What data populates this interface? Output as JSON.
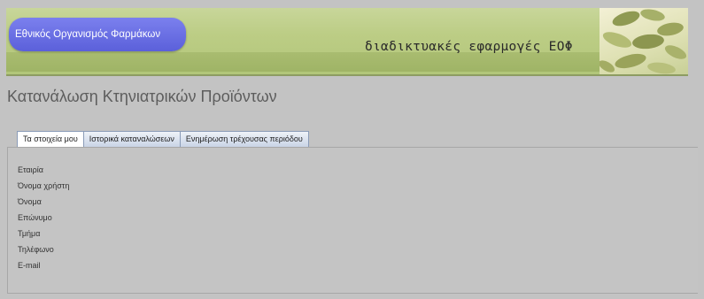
{
  "header": {
    "org_name": "Εθνικός Οργανισμός Φαρμάκων",
    "apps_title": "διαδικτυακές εφαρμογές ΕΟΦ"
  },
  "page": {
    "title": "Κατανάλωση Κτηνιατρικών Προϊόντων"
  },
  "tabs": [
    {
      "label": "Τα στοιχεία μου",
      "active": true
    },
    {
      "label": "Ιστορικά καταναλώσεων",
      "active": false
    },
    {
      "label": "Ενημέρωση τρέχουσας περιόδου",
      "active": false
    }
  ],
  "fields": [
    {
      "label": "Εταιρία"
    },
    {
      "label": "Όνομα χρήστη"
    },
    {
      "label": "Όνομα"
    },
    {
      "label": "Επώνυμο"
    },
    {
      "label": "Τμήμα"
    },
    {
      "label": "Τηλέφωνο"
    },
    {
      "label": "E-mail"
    }
  ],
  "colors": {
    "banner": "#bccd85",
    "org_pill": "#6b70e4",
    "background": "#c3c3c3"
  }
}
